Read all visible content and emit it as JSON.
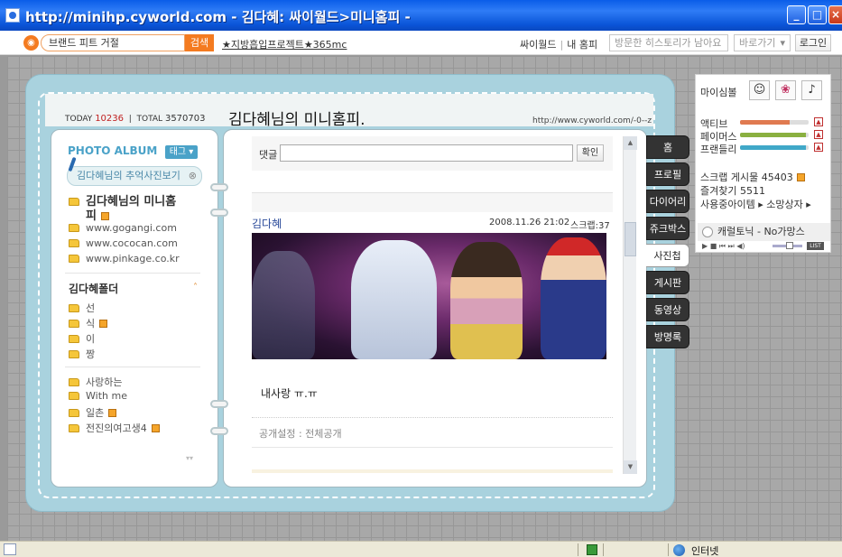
{
  "window": {
    "title": "http://minihp.cyworld.com - 김다혜: 싸이월드>미니홈피 -",
    "min": "_",
    "max": "□",
    "close": "×"
  },
  "topnav": {
    "search_value": "브랜드 피트 거절",
    "search_button": "검색",
    "promo": "★지방흡입프로젝트★365mc",
    "cyworld": "싸이월드",
    "separator": "|",
    "my_home": "내 홈피",
    "history": "방문한 히스토리가 남아요",
    "goto": "바로가기",
    "login": "로그인"
  },
  "header": {
    "today_label": "TODAY",
    "today": "10236",
    "divider": "|",
    "total_label": "TOTAL",
    "total": "3570703",
    "title": "김다혜님의 미니홈피.",
    "url": "http://www.cyworld.com/-0--z"
  },
  "album": {
    "title": "PHOTO ALBUM",
    "tag_button": "태그 ▾",
    "memory_button": "김다혜님의 추억사진보기",
    "memory_close": "⊗",
    "folders_a": [
      {
        "label": "김다혜님의 미니홈",
        "new": false,
        "main": true
      },
      {
        "label": "피",
        "new": true,
        "main": true
      },
      {
        "label": "www.gogangi.com",
        "new": false
      },
      {
        "label": "www.cococan.com",
        "new": false
      },
      {
        "label": "www.pinkage.co.kr",
        "new": false
      }
    ],
    "section_title": "김다혜폴더",
    "section_caret": "˄",
    "folders_b": [
      {
        "label": "선",
        "new": false
      },
      {
        "label": "식",
        "new": true
      },
      {
        "label": "이",
        "new": false
      },
      {
        "label": "짱",
        "new": false
      }
    ],
    "folders_c": [
      {
        "label": "사랑하는",
        "new": false
      },
      {
        "label": "With me",
        "new": false
      },
      {
        "label": "일촌",
        "new": true
      },
      {
        "label": "전진의여고생4",
        "new": true
      }
    ],
    "more_arrow": "▾▾"
  },
  "post": {
    "comment_label": "댓글",
    "comment_value": "",
    "confirm": "확인",
    "author": "김다혜",
    "date": "2008.11.26 21:02",
    "scrap": "스크랩:37",
    "text": "내사랑 ㅠ.ㅠ",
    "privacy": "공개설정 : 전체공개",
    "scroll_up": "▲",
    "scroll_down": "▼"
  },
  "tabs": [
    "홈",
    "프로필",
    "다이어리",
    "쥬크박스",
    "사진첩",
    "게시판",
    "동영상",
    "방명록"
  ],
  "active_tab": "사진첩",
  "panel": {
    "mood_label": "마이심볼",
    "mood_icons": [
      "☺",
      "❀",
      "♪"
    ],
    "stats": [
      {
        "label": "액티브",
        "fill": 0.72,
        "color": "#e07a50"
      },
      {
        "label": "페이머스",
        "fill": 0.96,
        "color": "#8ab040"
      },
      {
        "label": "프랜들리",
        "fill": 0.96,
        "color": "#40a8c8"
      }
    ],
    "stat_up": "▲",
    "scrap_board": "스크랩 게시물 45403",
    "favorites": "즐겨찾기 5511",
    "items": "사용중아이템 ▸ 소망상자 ▸",
    "music": "캐럴토닉 - No가망스",
    "player": "▶ ■ ⏮ ⏭  ◀)",
    "list": "LIST"
  },
  "status": {
    "zone": "인터넷"
  }
}
